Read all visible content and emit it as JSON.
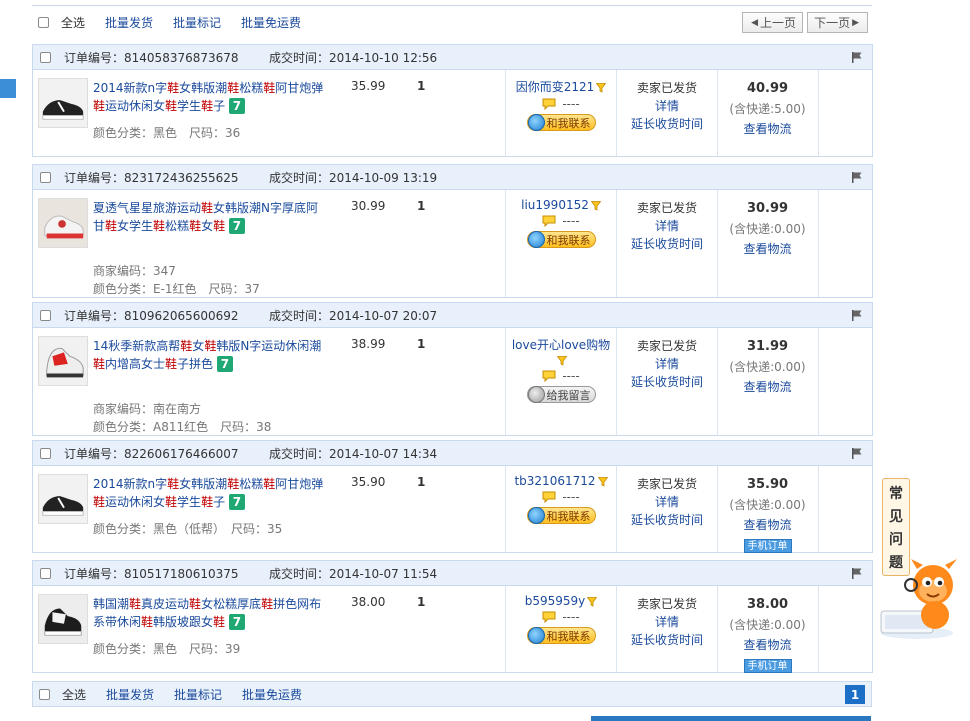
{
  "bulk_top": {
    "select_all": "全选",
    "batch_ship": "批量发货",
    "batch_mark": "批量标记",
    "batch_free_ship": "批量免运费"
  },
  "pager": {
    "prev": "上一页",
    "next": "下一页"
  },
  "labels": {
    "order_no": "订单编号：",
    "deal_time": "成交时间："
  },
  "orders": [
    {
      "order_no": "814058376873678",
      "time": "2014-10-10 12:56",
      "title_parts": [
        "2014新款n字",
        "鞋",
        "女韩版潮",
        "鞋",
        "松糕",
        "鞋",
        "阿甘炮弹",
        "鞋",
        "运动休闲女",
        "鞋",
        "学生",
        "鞋",
        "子"
      ],
      "meta": [
        "颜色分类：黑色　尺码：36"
      ],
      "price": "35.99",
      "qty": "1",
      "buyer": "因你而变2121",
      "buyer_extra": "----",
      "contact": "和我联系",
      "status": "卖家已发货",
      "detail": "详情",
      "extend": "延长收货时间",
      "total": "40.99",
      "shipping": "(含快递:5.00)",
      "logistics": "查看物流",
      "mobile": ""
    },
    {
      "order_no": "823172436255625",
      "time": "2014-10-09 13:19",
      "title_parts": [
        "夏透气星星旅游运动",
        "鞋",
        "女韩版潮N字厚底阿甘",
        "鞋",
        "女学生",
        "鞋",
        "松糕",
        "鞋",
        "女",
        "鞋"
      ],
      "meta": [
        "商家编码：347",
        "颜色分类：E-1红色　尺码：37"
      ],
      "price": "30.99",
      "qty": "1",
      "buyer": "liu1990152",
      "buyer_extra": "----",
      "contact": "和我联系",
      "status": "卖家已发货",
      "detail": "详情",
      "extend": "延长收货时间",
      "total": "30.99",
      "shipping": "(含快递:0.00)",
      "logistics": "查看物流",
      "mobile": ""
    },
    {
      "order_no": "810962065600692",
      "time": "2014-10-07 20:07",
      "title_parts": [
        "14秋季新款高帮",
        "鞋",
        "女",
        "鞋",
        "韩版N字运动休闲潮",
        "鞋",
        "内增高女士",
        "鞋",
        "子拼色"
      ],
      "meta": [
        "商家编码：南在南方",
        "颜色分类：A811红色　尺码：38"
      ],
      "price": "38.99",
      "qty": "1",
      "buyer": "love开心love购物",
      "buyer_extra": "----",
      "contact": "给我留言",
      "status": "卖家已发货",
      "detail": "详情",
      "extend": "延长收货时间",
      "total": "31.99",
      "shipping": "(含快递:0.00)",
      "logistics": "查看物流",
      "mobile": ""
    },
    {
      "order_no": "822606176466007",
      "time": "2014-10-07 14:34",
      "title_parts": [
        "2014新款n字",
        "鞋",
        "女韩版潮",
        "鞋",
        "松糕",
        "鞋",
        "阿甘炮弹",
        "鞋",
        "运动休闲女",
        "鞋",
        "学生",
        "鞋",
        "子"
      ],
      "meta": [
        "颜色分类：黑色（低帮）　尺码：35"
      ],
      "price": "35.90",
      "qty": "1",
      "buyer": "tb321061712",
      "buyer_extra": "----",
      "contact": "和我联系",
      "status": "卖家已发货",
      "detail": "详情",
      "extend": "延长收货时间",
      "total": "35.90",
      "shipping": "(含快递:0.00)",
      "logistics": "查看物流",
      "mobile": "手机订单"
    },
    {
      "order_no": "810517180610375",
      "time": "2014-10-07 11:54",
      "title_parts": [
        "韩国潮",
        "鞋",
        "真皮运动",
        "鞋",
        "女松糕厚底",
        "鞋",
        "拼色网布系带休闲",
        "鞋",
        "韩版坡跟女",
        "鞋"
      ],
      "meta": [
        "颜色分类：黑色　尺码：39"
      ],
      "price": "38.00",
      "qty": "1",
      "buyer": "b595959y",
      "buyer_extra": "----",
      "contact": "和我联系",
      "status": "卖家已发货",
      "detail": "详情",
      "extend": "延长收货时间",
      "total": "38.00",
      "shipping": "(含快递:0.00)",
      "logistics": "查看物流",
      "mobile": "手机订单"
    }
  ],
  "bulk_bottom": {
    "select_all": "全选",
    "batch_ship": "批量发货",
    "batch_mark": "批量标记",
    "batch_free_ship": "批量免运费",
    "page": "1"
  },
  "faq": {
    "chars": [
      "常",
      "见",
      "问",
      "题"
    ]
  },
  "colors": {
    "link": "#1a4a9c",
    "highlight": "#c00000",
    "header_bg": "#e8f1fb",
    "border": "#c9d9ee"
  }
}
